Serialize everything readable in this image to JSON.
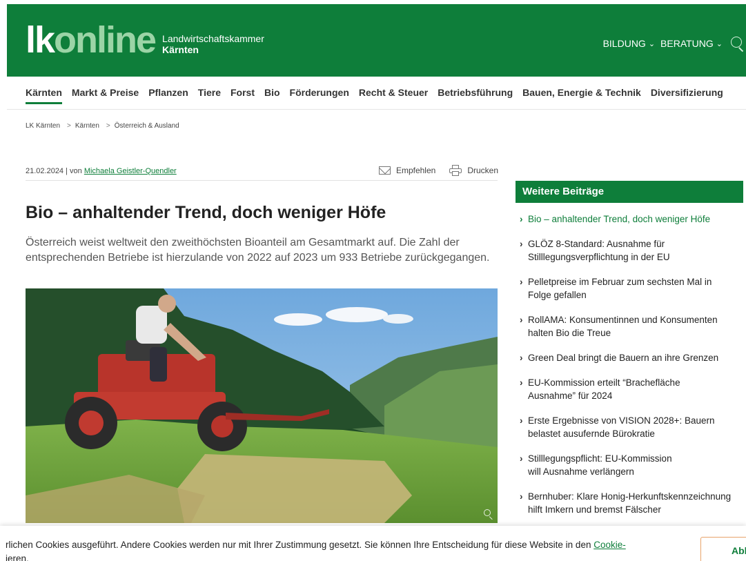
{
  "header": {
    "logo_lk": "lk",
    "logo_online": "online",
    "logo_sub_line1": "Landwirtschaftskammer",
    "logo_sub_line2": "Kärnten",
    "nav": [
      {
        "label": "BILDUNG"
      },
      {
        "label": "BERATUNG"
      }
    ],
    "brand_color": "#0e7e3a"
  },
  "mainnav": {
    "items": [
      {
        "label": "Kärnten",
        "active": true
      },
      {
        "label": "Markt & Preise"
      },
      {
        "label": "Pflanzen"
      },
      {
        "label": "Tiere"
      },
      {
        "label": "Forst"
      },
      {
        "label": "Bio"
      },
      {
        "label": "Förderungen"
      },
      {
        "label": "Recht & Steuer"
      },
      {
        "label": "Betriebsführung"
      },
      {
        "label": "Bauen, Energie & Technik"
      },
      {
        "label": "Diversifizierung"
      }
    ]
  },
  "breadcrumb": {
    "items": [
      "LK Kärnten",
      "Kärnten",
      "Österreich & Ausland"
    ],
    "separator": ">"
  },
  "article": {
    "date": "21.02.2024",
    "by": " | von ",
    "author": "Michaela Geistler-Quendler",
    "recommend_label": "Empfehlen",
    "print_label": "Drucken",
    "title": "Bio – anhaltender Trend, doch weniger Höfe",
    "lead_line1": "Österreich weist weltweit den zweithöchsten Bioanteil am Gesamtmarkt auf. Die Zahl der",
    "lead_line2": "entsprechenden Betriebe ist hierzulande von 2022 auf 2023 um 933 Betriebe zurückgegangen."
  },
  "sidebar": {
    "heading": "Weitere Beiträge",
    "items": [
      {
        "line1": "Bio – anhaltender Trend, doch weniger Höfe",
        "line2": ""
      },
      {
        "line1": "GLÖZ 8-Standard: Ausnahme für",
        "line2": "Stilllegungsverpflichtung in der EU"
      },
      {
        "line1": "Pelletpreise im Februar zum sechsten Mal in",
        "line2": "Folge gefallen"
      },
      {
        "line1": "RollAMA: Konsumentinnen und Konsumenten",
        "line2": "halten Bio die Treue"
      },
      {
        "line1": "Green Deal bringt die Bauern an ihre Grenzen",
        "line2": ""
      },
      {
        "line1": "EU-Kommission erteilt “Brachefläche",
        "line2": "Ausnahme” für 2024"
      },
      {
        "line1": "Erste Ergebnisse von VISION 2028+: Bauern",
        "line2": "belastet ausufernde Bürokratie"
      },
      {
        "line1": "Stilllegungspflicht: EU-Kommission",
        "line2": "will Ausnahme verlängern"
      },
      {
        "line1": "Bernhuber: Klare Honig-Herkunftskennzeichnung",
        "line2": "hilft Imkern und bremst Fälscher"
      }
    ]
  },
  "cookie": {
    "line1_text": "rlichen Cookies ausgeführt. Andere Cookies werden nur mit Ihrer Zustimmung gesetzt. Sie können Ihre Entscheidung für diese Website in den ",
    "line1_link": "Cookie-",
    "line2_text": "ieren.",
    "button_label": "Abl"
  }
}
